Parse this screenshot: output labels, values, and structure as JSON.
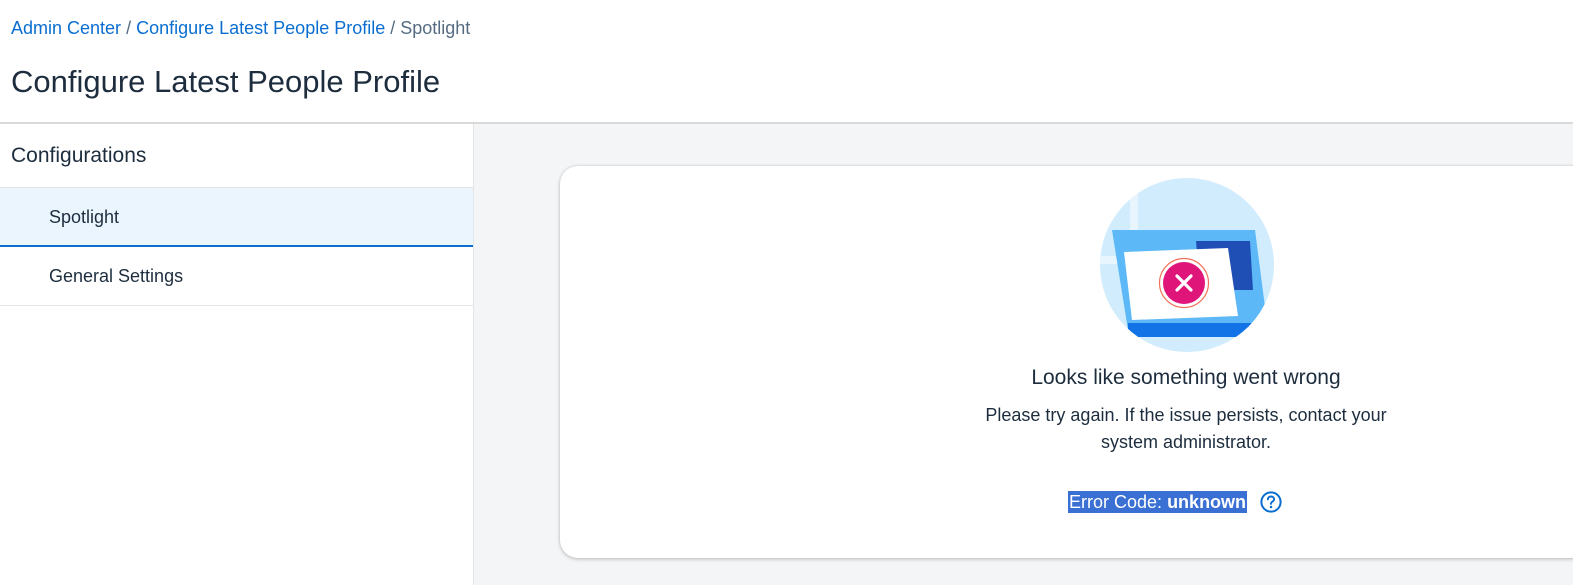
{
  "breadcrumb": {
    "items": [
      "Admin Center",
      "Configure Latest People Profile"
    ],
    "separator": "/",
    "current": "Spotlight"
  },
  "page": {
    "title": "Configure Latest People Profile"
  },
  "sidebar": {
    "heading": "Configurations",
    "items": [
      {
        "label": "Spotlight",
        "active": true
      },
      {
        "label": "General Settings",
        "active": false
      }
    ]
  },
  "error": {
    "illustration_icon": "broken-window-error-icon",
    "title": "Looks like something went wrong",
    "description": "Please try again. If the issue persists, contact your system administrator.",
    "code_label": "Error Code:",
    "code_value": "unknown",
    "help_icon": "help-circle-icon"
  },
  "colors": {
    "link": "#0a6ed1",
    "active_bg": "#eaf5fe",
    "main_bg": "#f4f5f7",
    "error_badge": "#e0157a",
    "selection": "#3a6fd4"
  }
}
